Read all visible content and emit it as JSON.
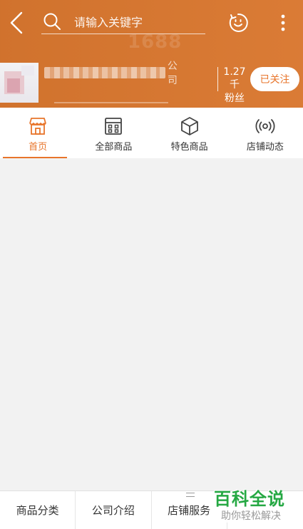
{
  "header": {
    "search_placeholder": "请输入关键字",
    "watermark_text": "1688"
  },
  "shop": {
    "name_suffix": "公司",
    "fans_count": "1.27千",
    "fans_label": "粉丝",
    "follow_label": "已关注"
  },
  "tabs": [
    {
      "label": "首页",
      "icon": "store-icon",
      "active": true
    },
    {
      "label": "全部商品",
      "icon": "grid-box-icon",
      "active": false
    },
    {
      "label": "特色商品",
      "icon": "cube-icon",
      "active": false
    },
    {
      "label": "店铺动态",
      "icon": "broadcast-icon",
      "active": false
    }
  ],
  "bottom_nav": [
    {
      "label": "商品分类"
    },
    {
      "label": "公司介绍"
    },
    {
      "label": "店铺服务"
    },
    {
      "label": ""
    }
  ],
  "brand": {
    "title": "百科全说",
    "subtitle": "助你轻松解决"
  },
  "colors": {
    "header_bg": "#d9772f",
    "accent": "#e8752b",
    "brand_green": "#25a843"
  }
}
